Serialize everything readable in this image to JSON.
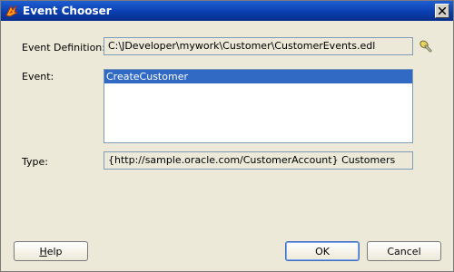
{
  "window": {
    "title": "Event Chooser"
  },
  "form": {
    "event_definition_label": "Event Definition:",
    "event_definition_value": "C:\\JDeveloper\\mywork\\Customer\\CustomerEvents.edl",
    "event_label": "Event:",
    "events": [
      "CreateCustomer"
    ],
    "selected_event": "CreateCustomer",
    "type_label": "Type:",
    "type_value": "{http://sample.oracle.com/CustomerAccount} Customers"
  },
  "buttons": {
    "help_first": "H",
    "help_rest": "elp",
    "ok": "OK",
    "cancel": "Cancel"
  },
  "icons": {
    "title": "oracle-jdev-icon",
    "close": "close-icon",
    "browse": "flashlight-icon"
  }
}
